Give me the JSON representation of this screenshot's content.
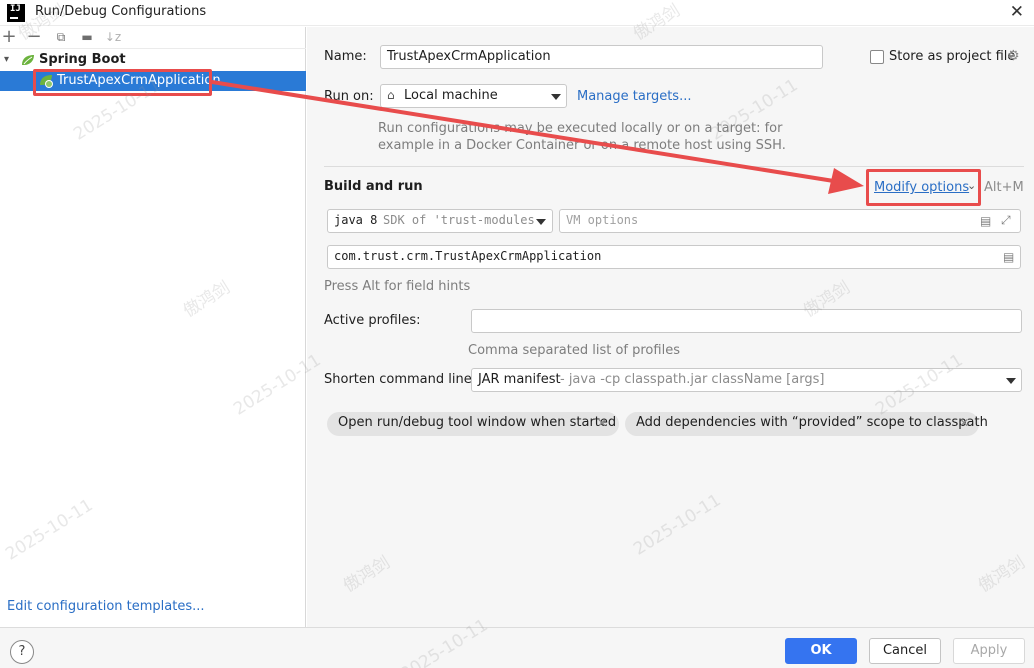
{
  "window": {
    "title": "Run/Debug Configurations",
    "app_icon_text": "IJ"
  },
  "toolbar": {
    "add": "+",
    "remove": "−",
    "copy": "⧉",
    "folder": "▬",
    "sort": "↓z"
  },
  "tree": {
    "group_label": "Spring Boot",
    "item_label": "TrustApexCrmApplication"
  },
  "left_footer": {
    "edit_templates": "Edit configuration templates..."
  },
  "form": {
    "name_label": "Name:",
    "name_value": "TrustApexCrmApplication",
    "store_label": "Store as project file",
    "run_on_label": "Run on:",
    "run_on_value": "Local machine",
    "manage_targets": "Manage targets...",
    "run_hint_line1": "Run configurations may be executed locally or on a target: for",
    "run_hint_line2": "example in a Docker Container or on a remote host using SSH.",
    "build_run_label": "Build and run",
    "modify_options": "Modify options",
    "modify_shortcut": "Alt+M",
    "sdk_java": "java 8",
    "sdk_detail": "SDK of 'trust-modules",
    "vm_placeholder": "VM options",
    "main_class": "com.trust.crm.TrustApexCrmApplication",
    "alt_hint": "Press Alt for field hints",
    "active_profiles_label": "Active profiles:",
    "active_profiles_value": "",
    "profiles_hint": "Comma separated list of profiles",
    "shorten_label": "Shorten command line:",
    "shorten_value": "JAR manifest",
    "shorten_detail": " - java -cp classpath.jar className [args]",
    "chip1": "Open run/debug tool window when started",
    "chip2": "Add dependencies with “provided” scope to classpath"
  },
  "buttons": {
    "help": "?",
    "ok": "OK",
    "cancel": "Cancel",
    "apply": "Apply"
  },
  "watermarks": {
    "date": "2025-10-11",
    "name": "傲鸿剑"
  },
  "colors": {
    "selection": "#2a7ad6",
    "link": "#2a6ec5",
    "ok_button": "#3574f0",
    "annotation_red": "#e84c4c"
  }
}
